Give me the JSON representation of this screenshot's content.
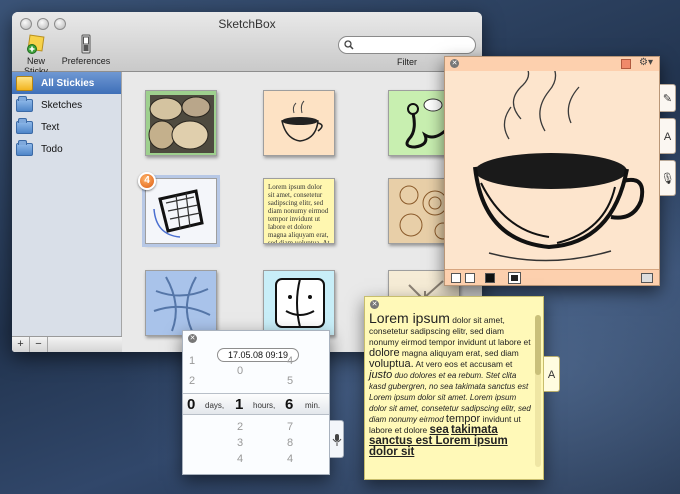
{
  "app": {
    "title": "SketchBox",
    "toolbar": {
      "new_sticky": "New Sticky",
      "preferences": "Preferences",
      "search_placeholder": "",
      "filter_label": "Filter"
    }
  },
  "sidebar": {
    "items": [
      {
        "label": "All Stickies",
        "selected": true,
        "icon": "all-stickies-icon"
      },
      {
        "label": "Sketches",
        "selected": false,
        "icon": "folder-icon"
      },
      {
        "label": "Text",
        "selected": false,
        "icon": "folder-icon"
      },
      {
        "label": "Todo",
        "selected": false,
        "icon": "folder-icon"
      }
    ],
    "add_button": "+",
    "remove_button": "−"
  },
  "grid": {
    "badge_count": "4",
    "lorem_preview": "Lorem ipsum dolor sit amet, consetetur sadipscing elitr, sed diam nonumy eirmod tempor invidunt ut labore et dolore magna aliquyam erat, sed diam voluptua. At vero eos et accusam et justo duo dolores et ea rebum. Stet clita kasd gubergren, no sea takimata"
  },
  "text_sticky": {
    "intro": "Lorem ipsum",
    "p1": " dolor sit amet, consetetur sadipscing elitr, sed diam nonumy eirmod tempor invidunt ut labore et ",
    "dolore": "dolore",
    "p2": " magna aliquyam erat, sed diam ",
    "voluptua": "voluptua.",
    "p3": " At vero eos et accusam et ",
    "justo": "justo",
    "p4": " duo dolores et ea rebum. Stet clita kasd gubergren, no sea takimata sanctus est Lorem ipsum dolor sit amet. Lorem ipsum dolor sit amet, consetetur sadipscing elitr, sed diam nonumy eirmod ",
    "tempor": "tempor",
    "p5": " invidunt ut labore et dolore ",
    "sea": "sea",
    "p6": "takimata sanctus est Lorem ipsum dolor sit",
    "side_tab": "A"
  },
  "sketch_window": {
    "side_tab_text": "A"
  },
  "timer": {
    "date": "17.05.08 09:19",
    "days_label": "days,",
    "hours_label": "hours,",
    "min_label": "min.",
    "days_value": "0",
    "hours_value": "1",
    "min_value": "6",
    "col1_above": [
      "1",
      "2"
    ],
    "col2_above": [
      "0"
    ],
    "col3_above": [
      "4",
      "5"
    ],
    "col2_below": [
      "2",
      "3"
    ],
    "col3_below": [
      "7",
      "8"
    ],
    "col1_below": [],
    "col2_far": [
      "4"
    ],
    "col3_far": [
      "5",
      "4"
    ]
  },
  "colors": {
    "sketch_bg": "#fde5cd",
    "text_sticky_bg": "#fff9b8",
    "selection_blue": "#3e6fb8"
  }
}
